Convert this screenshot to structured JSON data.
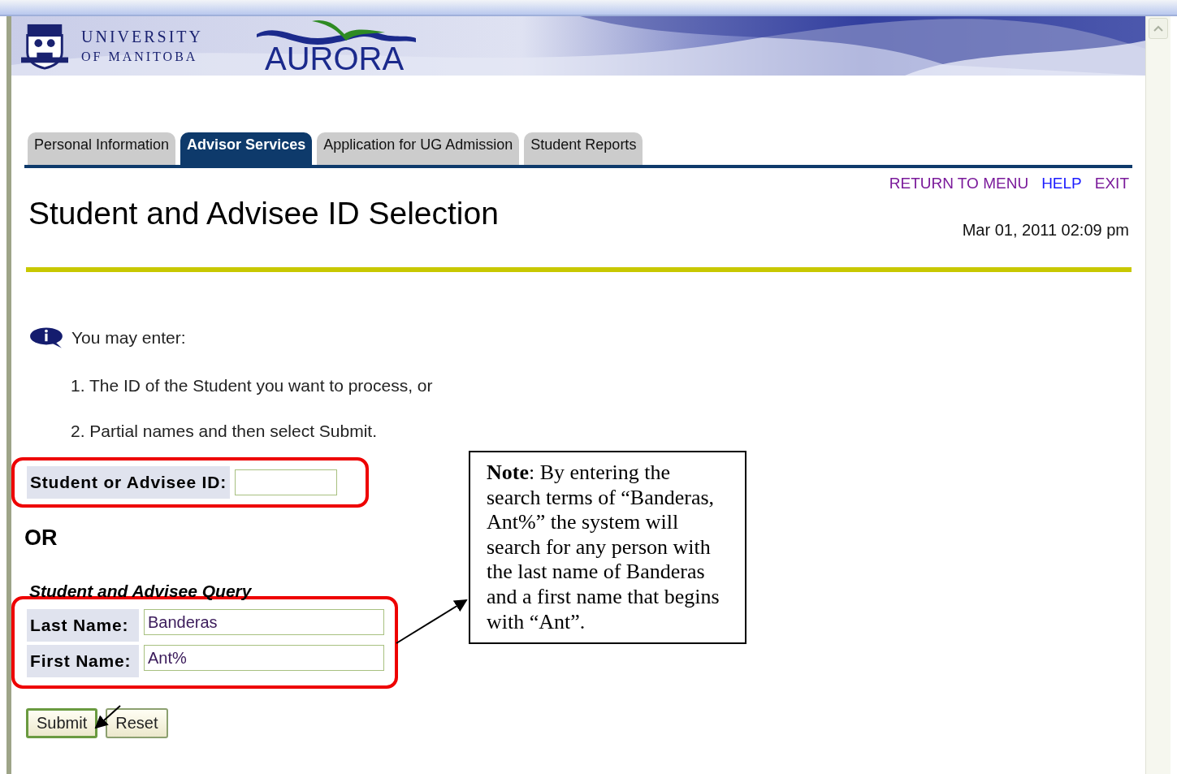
{
  "banner": {
    "university": "UNIVERSITY",
    "university_sub": "OF MANITOBA",
    "product": "AURORA"
  },
  "tabs": [
    {
      "label": "Personal Information",
      "selected": false
    },
    {
      "label": "Advisor Services",
      "selected": true
    },
    {
      "label": "Application for UG Admission",
      "selected": false
    },
    {
      "label": "Student Reports",
      "selected": false
    }
  ],
  "links": [
    {
      "label": "RETURN TO MENU",
      "visited": true
    },
    {
      "label": "HELP",
      "visited": false
    },
    {
      "label": "EXIT",
      "visited": true
    }
  ],
  "page_title": "Student and Advisee ID Selection",
  "timestamp": "Mar 01, 2011 02:09 pm",
  "info": {
    "intro": "You may enter:",
    "items": [
      "1. The ID of the Student you want to process, or",
      "2. Partial names and then select Submit."
    ]
  },
  "id_field": {
    "label": "Student or Advisee ID:"
  },
  "or_label": "OR",
  "query": {
    "heading": "Student and Advisee Query",
    "fields": [
      {
        "label": "Last Name:",
        "value": "Banderas"
      },
      {
        "label": "First Name:",
        "value": "Ant%"
      }
    ]
  },
  "buttons": [
    {
      "label": "Submit",
      "kind": "primary"
    },
    {
      "label": "Reset",
      "kind": "secondary"
    }
  ],
  "note": "**Note**:  By entering the search terms of “Banderas, Ant%” the system will search for any person with the last name of Banderas and a first name that begins with “Ant”."
}
